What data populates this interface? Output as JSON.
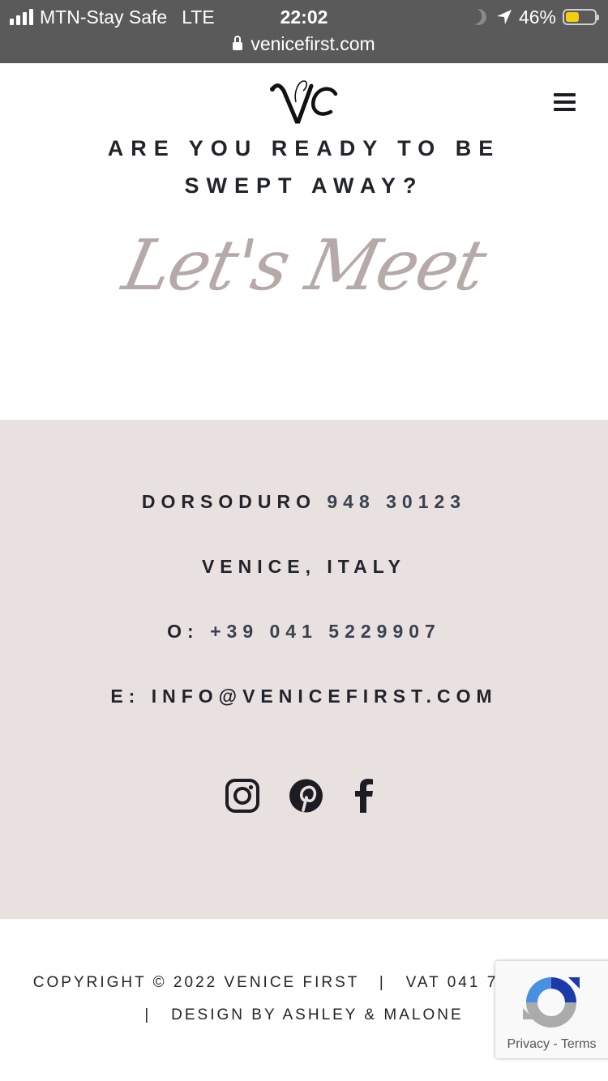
{
  "status_bar": {
    "carrier": "MTN-Stay Safe",
    "network": "LTE",
    "time": "22:02",
    "battery_percent": "46%",
    "battery_level": 0.46,
    "url": "venicefirst.com",
    "colors": {
      "bar_bg": "#5a5a5a",
      "battery_fill": "#f5cd10"
    }
  },
  "header": {
    "logo_icon": "venice-first-monogram",
    "menu_icon": "hamburger-icon"
  },
  "hero": {
    "heading_partial": "ARE YOU READY TO BE",
    "heading": "SWEPT AWAY?",
    "script_title": "Let's Meet",
    "colors": {
      "script": "#b6aaa9"
    }
  },
  "contact": {
    "address_street": "DORSODURO",
    "address_number": "948 30123",
    "address_city": "VENICE, ITALY",
    "phone_label": "O:",
    "phone_number": "+39 041 5229907",
    "email_label": "E:",
    "email": "INFO@VENICEFIRST.COM",
    "social_icons": [
      "instagram-icon",
      "pinterest-icon",
      "facebook-icon"
    ],
    "colors": {
      "band_bg": "#e8e1e0"
    }
  },
  "footer": {
    "line1": "COPYRIGHT © 2022 VENICE FIRST   |   VAT 041 72550271",
    "line2": "|   DESIGN BY ASHLEY & MALONE"
  },
  "recaptcha": {
    "privacy": "Privacy",
    "separator": "-",
    "terms": "Terms"
  }
}
